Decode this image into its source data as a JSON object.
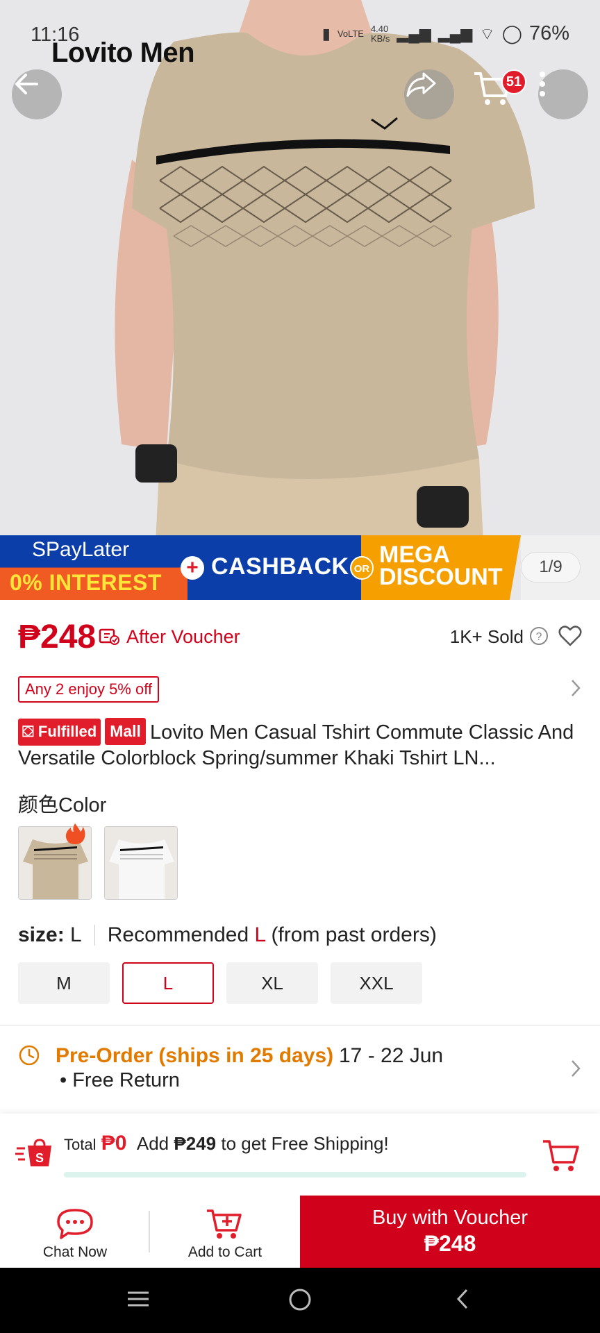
{
  "status_bar": {
    "time": "11:16",
    "network_speed": "4.40\nKB/s",
    "battery": "76%"
  },
  "hero": {
    "brand_text": "Lovito Men",
    "cart_count": "51",
    "page_indicator": "1/9"
  },
  "banner": {
    "paylater_title": "SPayLater",
    "paylater_sub": "0% INTEREST",
    "cashback": "CASHBACK",
    "or": "OR",
    "mega_line1": "MEGA",
    "mega_line2": "DISCOUNT"
  },
  "price": {
    "amount": "₱248",
    "after_voucher": "After Voucher",
    "sold": "1K+ Sold"
  },
  "promo": {
    "tag": "Any 2 enjoy 5% off"
  },
  "product": {
    "badge_fulfilled": "Fulfilled",
    "badge_mall": "Mall",
    "title": "Lovito Men Casual Tshirt Commute Classic And Versatile Colorblock Spring/summer Khaki Tshirt LN..."
  },
  "color": {
    "label": "颜色Color"
  },
  "size": {
    "label": "size:",
    "selected": "L",
    "rec_prefix": "Recommended",
    "rec_size": "L",
    "rec_suffix": "(from past orders)",
    "options": [
      "M",
      "L",
      "XL",
      "XXL"
    ]
  },
  "shipping": {
    "preorder": "Pre-Order (ships in 25 days)",
    "dates": "17 - 22 Jun",
    "free_return": "• Free Return"
  },
  "free_ship": {
    "total_label": "Total",
    "total_amount": "₱0",
    "add_prefix": "Add",
    "add_amount": "₱249",
    "add_suffix": "to get Free Shipping!"
  },
  "bottom_bar": {
    "chat": "Chat Now",
    "add_cart": "Add to Cart",
    "buy_label": "Buy with Voucher",
    "buy_price": "₱248"
  },
  "colors": {
    "accent_red": "#d0021b",
    "preorder_orange": "#e07b00",
    "khaki_shirt": "#c9b79c"
  }
}
